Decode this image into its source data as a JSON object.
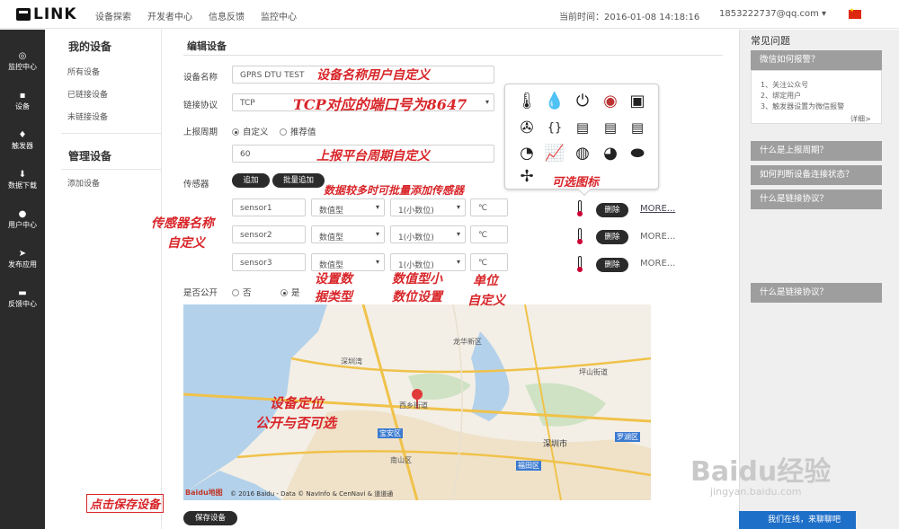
{
  "brand": {
    "logo_text": "LINK"
  },
  "topnav": [
    "设备探索",
    "开发者中心",
    "信息反馈",
    "监控中心"
  ],
  "current_time": "当前时间：2016-01-08 14:18:16",
  "user_email": "1853222737@qq.com ▾",
  "sidebar": [
    {
      "label": "监控中心",
      "icon": "target-icon"
    },
    {
      "label": "设备",
      "icon": "device-icon"
    },
    {
      "label": "触发器",
      "icon": "bell-icon"
    },
    {
      "label": "数据下载",
      "icon": "download-icon"
    },
    {
      "label": "用户中心",
      "icon": "user-icon"
    },
    {
      "label": "发布应用",
      "icon": "send-icon"
    },
    {
      "label": "反馈中心",
      "icon": "chat-icon"
    }
  ],
  "subnav": {
    "my_devices": "我的设备",
    "my_items": [
      "所有设备",
      "已链接设备",
      "未链接设备"
    ],
    "manage": "管理设备",
    "manage_items": [
      "添加设备"
    ]
  },
  "form": {
    "title": "编辑设备",
    "device_name_label": "设备名称",
    "device_name_value": "GPRS DTU TEST",
    "protocol_label": "链接协议",
    "protocol_value": "TCP",
    "period_label": "上报周期",
    "period_custom": "自定义",
    "period_recommend": "推荐值",
    "period_value": "60",
    "sensor_label": "传感器",
    "add_btn": "追加",
    "batch_add_btn": "批量追加",
    "sensors": [
      {
        "name": "sensor1",
        "type": "数值型",
        "decimal": "1(小数位)",
        "unit": "℃",
        "more": "MORE..."
      },
      {
        "name": "sensor2",
        "type": "数值型",
        "decimal": "1(小数位)",
        "unit": "℃",
        "more": "MORE..."
      },
      {
        "name": "sensor3",
        "type": "数值型",
        "decimal": "1(小数位)",
        "unit": "℃",
        "more": "MORE..."
      }
    ],
    "delete_btn": "删除",
    "public_label": "是否公开",
    "public_no": "否",
    "public_yes": "是",
    "save_btn": "保存设备"
  },
  "annotations": {
    "name": "设备名称用户自定义",
    "tcp": "TCP对应的端口号为8647",
    "period": "上报平台周期自定义",
    "batch": "数据较多时可批量添加传感器",
    "icons": "可选图标",
    "sensor_name_1": "传感器名称",
    "sensor_name_2": "自定义",
    "type_1": "设置数",
    "type_2": "据类型",
    "dec_1": "数值型小",
    "dec_2": "数位设置",
    "unit_1": "单位",
    "unit_2": "自定义",
    "loc_1": "设备定位",
    "loc_2": "公开与否可选",
    "save": "点击保存设备"
  },
  "map": {
    "labels": [
      "深圳市",
      "福田区",
      "罗湖区",
      "宝安区",
      "南山区",
      "龙华新区",
      "深圳湾",
      "西乡街道",
      "坪山街道"
    ],
    "copyright": "© 2016 Baidu - Data © NavInfo & CenNavi & 道道通",
    "baidu": "Baidu地图"
  },
  "help": {
    "title": "常见问题",
    "q1": "微信如何报警？",
    "steps": [
      "1、关注公众号",
      "2、绑定用户",
      "3、触发器设置为微信报警"
    ],
    "detail": "详细>",
    "q2": "什么是上报周期？",
    "q3": "如何判断设备连接状态？",
    "q4": "什么是链接协议？",
    "q5": "什么是链接协议？"
  },
  "chat": "我们在线，来聊聊吧",
  "watermark": {
    "main": "Baidu经验",
    "sub": "jingyan.baidu.com"
  },
  "colors": {
    "annotation": "#d8262a",
    "sidebar": "#2b2b2b",
    "chat": "#1e6fc8"
  }
}
